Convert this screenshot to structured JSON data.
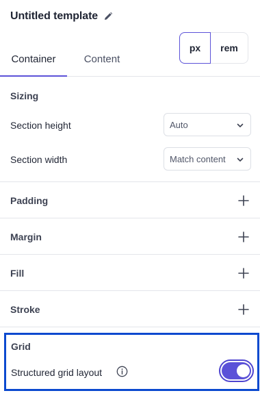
{
  "header": {
    "title": "Untitled template",
    "edit_icon": "pencil-icon"
  },
  "tabs": [
    {
      "label": "Container",
      "active": true
    },
    {
      "label": "Content",
      "active": false
    }
  ],
  "units": {
    "options": [
      "px",
      "rem"
    ],
    "selected": "px"
  },
  "sizing": {
    "label": "Sizing",
    "section_height": {
      "label": "Section height",
      "value": "Auto"
    },
    "section_width": {
      "label": "Section width",
      "value": "Match content"
    }
  },
  "collapsed_sections": [
    {
      "label": "Padding",
      "icon": "plus-icon"
    },
    {
      "label": "Margin",
      "icon": "plus-icon"
    },
    {
      "label": "Fill",
      "icon": "plus-icon"
    },
    {
      "label": "Stroke",
      "icon": "plus-icon"
    }
  ],
  "grid": {
    "label": "Grid",
    "structured_layout_label": "Structured grid layout",
    "info_icon": "info-icon",
    "enabled": true
  },
  "colors": {
    "accent": "#5b51d8",
    "highlight_border": "#0b49cf",
    "divider": "#e3e5ea"
  }
}
